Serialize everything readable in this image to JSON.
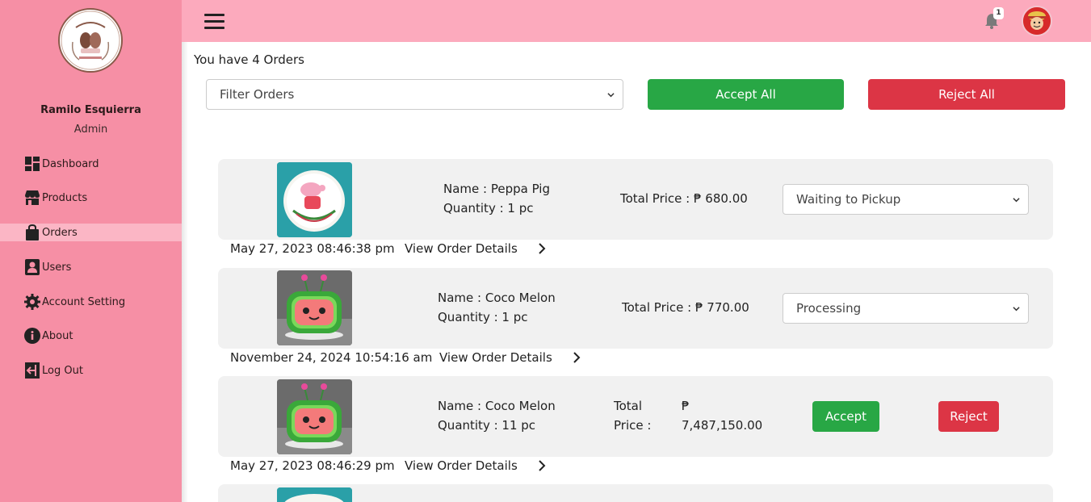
{
  "sidebar": {
    "user_name": "Ramilo Esquierra",
    "user_role": "Admin",
    "items": [
      {
        "label": "Dashboard",
        "icon": "dashboard-icon"
      },
      {
        "label": "Products",
        "icon": "store-icon"
      },
      {
        "label": "Orders",
        "icon": "shopping-bag-icon",
        "active": true
      },
      {
        "label": "Users",
        "icon": "user-icon"
      },
      {
        "label": "Account Setting",
        "icon": "gear-icon"
      },
      {
        "label": "About",
        "icon": "info-icon"
      },
      {
        "label": "Log Out",
        "icon": "logout-icon"
      }
    ]
  },
  "topbar": {
    "notification_count": "1"
  },
  "main": {
    "order_count_text": "You have 4 Orders",
    "filter_placeholder": "Filter Orders",
    "accept_all_label": "Accept All",
    "reject_all_label": "Reject All"
  },
  "orders": [
    {
      "name": "Name : Peppa Pig",
      "quantity": "Quantity : 1 pc",
      "total_price": "Total Price : ₱ 680.00",
      "status": "Waiting to Pickup",
      "date": "May 27, 2023 08:46:38 pm",
      "link": "View Order Details"
    },
    {
      "name": "Name : Coco Melon",
      "quantity": "Quantity : 1 pc",
      "total_price": "Total Price : ₱ 770.00",
      "status": "Processing",
      "date": "November 24, 2024 10:54:16 am",
      "link": "View Order Details"
    },
    {
      "name": "Name : Coco Melon",
      "quantity": "Quantity : 11 pc",
      "total_label_1": "Total",
      "total_label_2": "Price :",
      "currency": "₱",
      "amount": "7,487,150.00",
      "accept_label": "Accept",
      "reject_label": "Reject",
      "date": "May 27, 2023 08:46:29 pm",
      "link": "View Order Details"
    }
  ],
  "colors": {
    "sidebar": "#f68fa5",
    "topbar": "#fcaabd",
    "accept": "#28a745",
    "reject": "#dc3545"
  }
}
